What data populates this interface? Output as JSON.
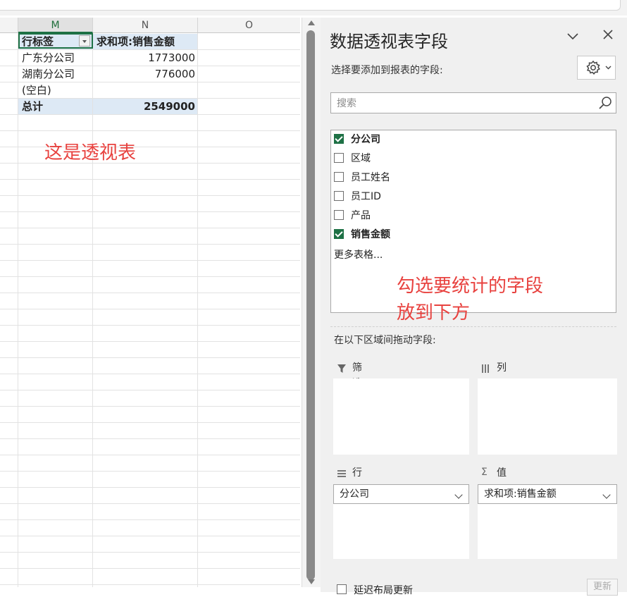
{
  "sheet": {
    "columns": [
      "M",
      "N",
      "O"
    ],
    "pivot": {
      "header": {
        "row_label": "行标签",
        "value_label": "求和项:销售金额"
      },
      "rows": [
        {
          "label": "广东分公司",
          "value": "1773000"
        },
        {
          "label": "湖南分公司",
          "value": "776000"
        },
        {
          "label": "(空白)",
          "value": ""
        }
      ],
      "total": {
        "label": "总计",
        "value": "2549000"
      }
    },
    "annotation": "这是透视表"
  },
  "pane": {
    "title": "数据透视表字段",
    "choose_label": "选择要添加到报表的字段:",
    "search_placeholder": "搜索",
    "fields": [
      {
        "label": "分公司",
        "checked": true
      },
      {
        "label": "区域",
        "checked": false
      },
      {
        "label": "员工姓名",
        "checked": false
      },
      {
        "label": "员工ID",
        "checked": false
      },
      {
        "label": "产品",
        "checked": false
      },
      {
        "label": "销售金额",
        "checked": true
      }
    ],
    "more_tables": "更多表格...",
    "annotation": "勾选要统计的字段\n放到下方",
    "drag_label": "在以下区域间拖动字段:",
    "areas": {
      "filter": {
        "label": "筛选"
      },
      "columns": {
        "label": "列"
      },
      "rows": {
        "label": "行",
        "item": "分公司"
      },
      "values": {
        "label": "值",
        "item": "求和项:销售金额"
      }
    },
    "defer_label": "延迟布局更新",
    "update_label": "更新"
  },
  "colors": {
    "accent_green": "#1e7145",
    "annotation_red": "#e8423f",
    "pivot_header_band": "#dde9f5"
  }
}
